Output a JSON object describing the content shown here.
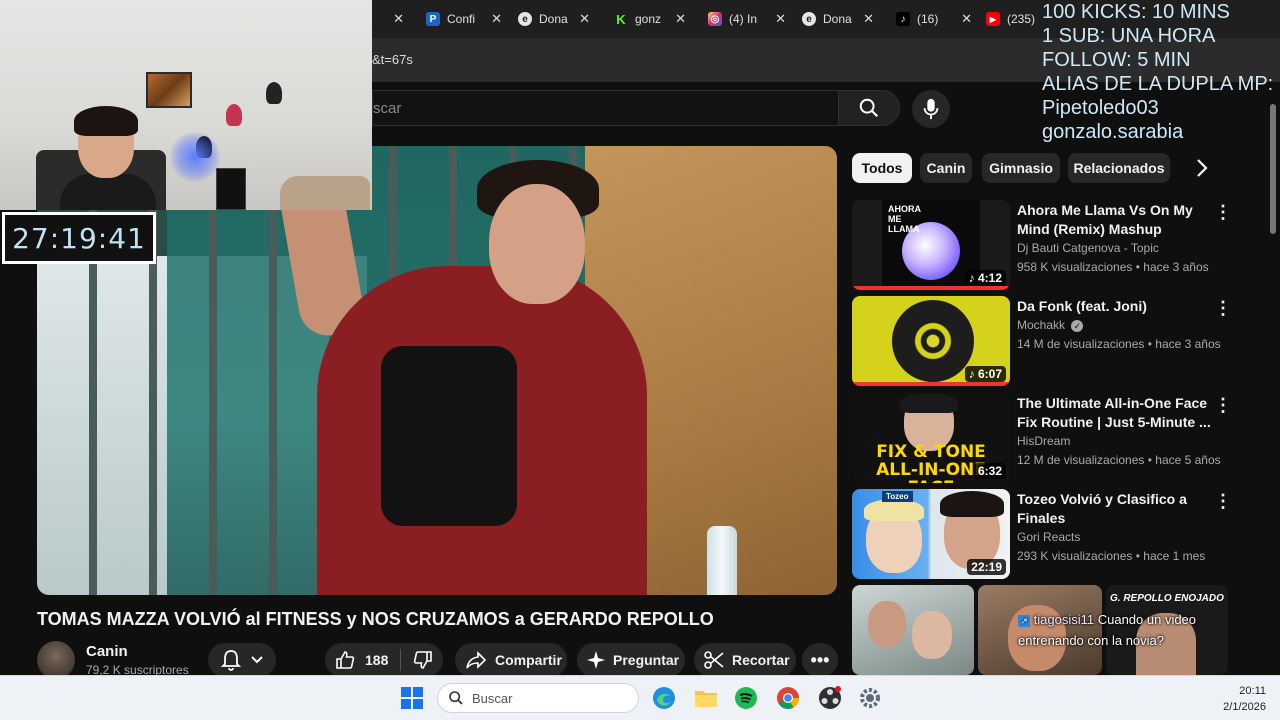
{
  "browser": {
    "tabs": [
      {
        "label": "",
        "icon": "close",
        "color": "#1f1f1f"
      },
      {
        "label": "Confi",
        "icon": "paypal-icon",
        "color": "#1e64c8"
      },
      {
        "label": "Dona",
        "icon": "donation-icon",
        "color": "#e6e6e6"
      },
      {
        "label": "gonz",
        "icon": "kick-icon",
        "color": "#53fc18"
      },
      {
        "label": "(4) In",
        "icon": "instagram-icon",
        "color": "#d62976"
      },
      {
        "label": "Dona",
        "icon": "donation-icon",
        "color": "#e6e6e6"
      },
      {
        "label": "(16)",
        "icon": "tiktok-icon",
        "color": "#000000"
      },
      {
        "label": "(235)",
        "icon": "youtube-icon",
        "color": "#ff0000"
      }
    ],
    "url": "&t=67s"
  },
  "youtube": {
    "search_placeholder": "scar",
    "chips": [
      "Todos",
      "Canin",
      "Gimnasio",
      "Relacionados"
    ],
    "video": {
      "title": "TOMAS MAZZA VOLVIÓ al FITNESS y NOS CRUZAMOS a GERARDO REPOLLO",
      "channel": "Canin",
      "subscribers": "79,2 K suscriptores",
      "likes": "188",
      "share_label": "Compartir",
      "ask_label": "Preguntar",
      "clip_label": "Recortar"
    },
    "recommendations": [
      {
        "title": "Ahora Me Llama Vs On My Mind (Remix) Mashup",
        "channel": "Dj Bauti Catgenova - Topic",
        "meta": "958 K visualizaciones • hace 3 años",
        "duration": "4:12",
        "thumb_text": "AHORA ME LLAMA"
      },
      {
        "title": "Da Fonk (feat. Joni)",
        "channel": "Mochakk",
        "meta": "14 M de visualizaciones • hace 3 años",
        "duration": "6:07",
        "thumb_text": ""
      },
      {
        "title": "The Ultimate All-in-One Face Fix Routine | Just 5-Minute ...",
        "channel": "HisDream",
        "meta": "12 M de visualizaciones • hace 5 años",
        "duration": "6:32",
        "thumb_text": "FIX & TONE ALL-IN-ONE FACE"
      },
      {
        "title": "Tozeo Volvió y Clasifico a Finales",
        "channel": "Gori Reacts",
        "meta": "293 K visualizaciones • hace 1 mes",
        "duration": "22:19",
        "thumb_text": "Tozeo"
      }
    ],
    "bottom_thumb_text": "G. REPOLLO ENOJADO"
  },
  "stream": {
    "timer": "27:19:41",
    "overlay_lines": [
      "100 KICKS: 10 MINS",
      "1 SUB: UNA HORA",
      "FOLLOW: 5 MIN",
      "ALIAS DE LA DUPLA MP:",
      "Pipetoledo03",
      "gonzalo.sarabia"
    ],
    "chat_user": "tiagosisi11",
    "chat_line1": "Cuando un video",
    "chat_line2": "entrenando con la novia?"
  },
  "taskbar": {
    "search_placeholder": "Buscar",
    "time": "20:11",
    "date": "2/1/2026"
  }
}
